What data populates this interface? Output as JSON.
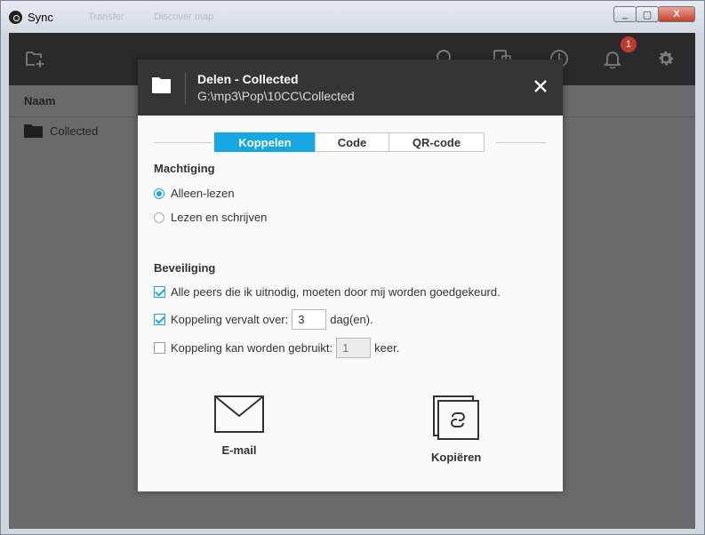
{
  "window": {
    "title": "Sync",
    "ghost_tabs": [
      "Sync",
      "Transfer",
      "Discover map"
    ],
    "buttons": {
      "minimize": "_",
      "maximize": "▢",
      "close": "X"
    }
  },
  "toolbar": {
    "icons": [
      "add-folder-icon",
      "search-icon",
      "devices-icon",
      "history-icon",
      "bell-icon",
      "gear-icon"
    ],
    "notification_count": "1"
  },
  "list": {
    "column_name": "Naam",
    "rows": [
      {
        "name": "Collected"
      }
    ]
  },
  "dialog": {
    "title": "Delen - Collected",
    "path": "G:\\mp3\\Pop\\10CC\\Collected",
    "tabs": [
      {
        "label": "Koppelen",
        "active": true
      },
      {
        "label": "Code",
        "active": false
      },
      {
        "label": "QR-code",
        "active": false
      }
    ],
    "permission": {
      "title": "Machtiging",
      "options": [
        {
          "label": "Alleen-lezen",
          "checked": true
        },
        {
          "label": "Lezen en schrijven",
          "checked": false
        }
      ]
    },
    "security": {
      "title": "Beveiliging",
      "approve_label": "Alle peers die ik uitnodig, moeten door mij worden goedgekeurd.",
      "approve_checked": true,
      "expire_label": "Koppeling vervalt over:",
      "expire_checked": true,
      "expire_value": "3",
      "expire_unit": "dag(en).",
      "uses_label": "Koppeling kan worden gebruikt:",
      "uses_checked": false,
      "uses_value": "1",
      "uses_unit": "keer."
    },
    "actions": {
      "email_label": "E-mail",
      "copy_label": "Kopiëren"
    }
  },
  "colors": {
    "accent": "#17a8e3",
    "toolbar": "#2a2a2a",
    "dialog_header": "#353535",
    "badge": "#c0392b"
  }
}
